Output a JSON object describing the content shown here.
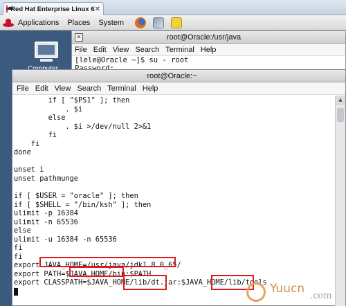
{
  "tab": {
    "title": "Red Hat Enterprise Linux 6",
    "close": "✕"
  },
  "panel": {
    "menus": [
      "Applications",
      "Places",
      "System"
    ]
  },
  "desktop": {
    "computer_label": "Computer"
  },
  "back_window": {
    "title": "root@Oracle:/usr/java",
    "menus": [
      "File",
      "Edit",
      "View",
      "Search",
      "Terminal",
      "Help"
    ],
    "lines": [
      "[lele@Oracle ~]$ su - root",
      "Password:"
    ]
  },
  "front_window": {
    "title": "root@Oracle:~",
    "menus": [
      "File",
      "Edit",
      "View",
      "Search",
      "Terminal",
      "Help"
    ],
    "lines": [
      "        if [ \"$PS1\" ]; then",
      "            . $i",
      "        else",
      "            . $i >/dev/null 2>&1",
      "        fi",
      "    fi",
      "done",
      "",
      "unset i",
      "unset pathmunge",
      "",
      "if [ $USER = \"oracle\" ]; then",
      "if [ $SHELL = \"/bin/ksh\" ]; then",
      "ulimit -p 16384",
      "ulimit -n 65536",
      "else",
      "ulimit -u 16384 -n 65536",
      "fi",
      "fi",
      "export JAVA_HOME=/usr/java/jdk1.8.0_65/",
      "export PATH=$JAVA_HOME/bin:$PATH",
      "export CLASSPATH=$JAVA_HOME/lib/dt.jar:$JAVA_HOME/lib/tools"
    ]
  },
  "watermark": {
    "text": "Yuucn",
    "sub": ".com"
  }
}
